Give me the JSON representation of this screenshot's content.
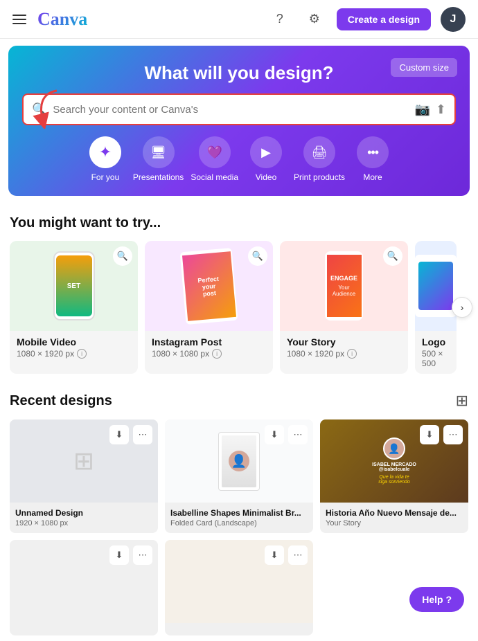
{
  "header": {
    "logo": "Canva",
    "help_label": "?",
    "settings_label": "⚙",
    "create_btn": "Create a design",
    "avatar_letter": "J"
  },
  "hero": {
    "title": "What will you design?",
    "custom_size_btn": "Custom size",
    "search_placeholder": "Search your content or Canva's"
  },
  "categories": [
    {
      "id": "for-you",
      "label": "For you",
      "icon": "✦",
      "active": true
    },
    {
      "id": "presentations",
      "label": "Presentations",
      "icon": "🖥",
      "active": false
    },
    {
      "id": "social-media",
      "label": "Social media",
      "icon": "💜",
      "active": false
    },
    {
      "id": "video",
      "label": "Video",
      "icon": "▶",
      "active": false
    },
    {
      "id": "print-products",
      "label": "Print products",
      "icon": "🖨",
      "active": false
    },
    {
      "id": "more",
      "label": "More",
      "icon": "•••",
      "active": false
    }
  ],
  "try_section": {
    "title": "You might want to try...",
    "items": [
      {
        "name": "Mobile Video",
        "size": "1080 × 1920 px",
        "type": "mobile-video"
      },
      {
        "name": "Instagram Post",
        "size": "1080 × 1080 px",
        "type": "instagram"
      },
      {
        "name": "Your Story",
        "size": "1080 × 1920 px",
        "type": "story"
      },
      {
        "name": "Logo",
        "size": "500 × 500",
        "type": "logo"
      }
    ]
  },
  "recent_section": {
    "title": "Recent designs",
    "items": [
      {
        "name": "Unnamed Design",
        "type": "1920 × 1080 px",
        "img_type": "unnamed"
      },
      {
        "name": "Isabelline Shapes Minimalist Br...",
        "type": "Folded Card (Landscape)",
        "img_type": "isabel"
      },
      {
        "name": "Historia Año Nuevo Mensaje de...",
        "type": "Your Story",
        "img_type": "historia"
      },
      {
        "name": "",
        "type": "",
        "img_type": "blank1"
      },
      {
        "name": "",
        "type": "",
        "img_type": "blank2"
      }
    ]
  },
  "help_btn": "Help ?",
  "icons": {
    "search": "🔍",
    "camera": "📷",
    "upload": "⬆",
    "zoom": "🔍",
    "download": "⬇",
    "more": "⋯",
    "grid": "⊞",
    "next": "›",
    "info": "i"
  }
}
